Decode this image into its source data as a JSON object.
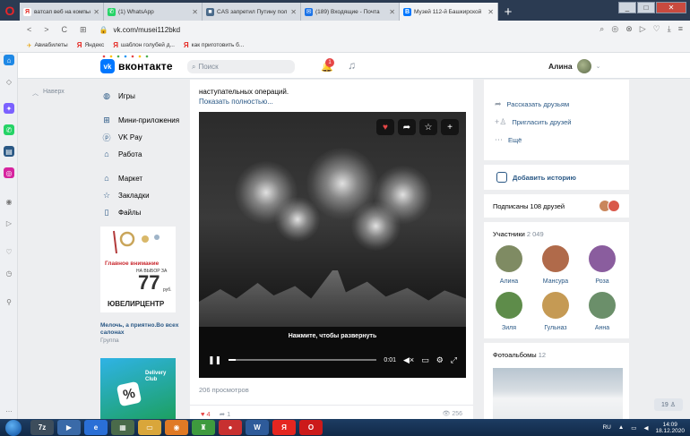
{
  "browser": {
    "tabs": [
      {
        "title": "ватсап веб на компьютер",
        "icon": "yandex-icon",
        "color": "#e52620",
        "glyph": "Я",
        "active": false
      },
      {
        "title": "(1) WhatsApp",
        "icon": "whatsapp-icon",
        "color": "#25d366",
        "glyph": "✆",
        "active": false
      },
      {
        "title": "CAS запретил Путину пол",
        "icon": "cas-icon",
        "color": "#4a6a8a",
        "glyph": "■",
        "active": false
      },
      {
        "title": "(189) Входящие - Почта",
        "icon": "mail-icon",
        "color": "#1a73e8",
        "glyph": "✉",
        "active": false
      },
      {
        "title": "Музей 112-й Башкирской",
        "icon": "vk-icon",
        "color": "#0077ff",
        "glyph": "В",
        "active": true
      }
    ],
    "url": "vk.com/musei112bkd",
    "bookmarks": [
      {
        "label": "Авиабилеты",
        "icon": "plane-icon"
      },
      {
        "label": "Яндекс",
        "icon": "yandex-icon"
      },
      {
        "label": "шаблон голубей д...",
        "icon": "yandex-icon"
      },
      {
        "label": "как приготовить б...",
        "icon": "yandex-icon"
      }
    ]
  },
  "vk": {
    "brand": "вконтакте",
    "search_placeholder": "Поиск",
    "notifications_count": "1",
    "user_name": "Алина",
    "back_to_top": "Наверх",
    "nav": [
      {
        "label": "Игры",
        "icon": "gamepad-icon",
        "badge": true
      },
      {
        "label": "Мини-приложения",
        "icon": "grid-icon"
      },
      {
        "label": "VK Pay",
        "icon": "pay-icon"
      },
      {
        "label": "Работа",
        "icon": "briefcase-icon"
      },
      {
        "label": "Маркет",
        "icon": "bag-icon"
      },
      {
        "label": "Закладки",
        "icon": "star-icon"
      },
      {
        "label": "Файлы",
        "icon": "file-icon"
      }
    ],
    "ad1": {
      "headline": "Главное внимание",
      "sub": "НА ВЫБОР ЗА",
      "price": "77",
      "unit": "руб.",
      "brand": "ЮВЕЛИРЦЕНТР",
      "text": "Мелочь, а приятно.Во всех салонах",
      "group": "Группа"
    },
    "ad2": {
      "label": "Delivery Club",
      "pct": "%"
    },
    "post": {
      "text": "наступательных операций.",
      "show_more": "Показать полностью...",
      "expand_hint": "Нажмите, чтобы развернуть",
      "time": "0:01",
      "progress": 0.05,
      "views": "206 просмотров",
      "likes": "4",
      "shares": "1",
      "eye_views": "256"
    },
    "right": {
      "share_friends": "Рассказать друзьям",
      "invite_friends": "Пригласить друзей",
      "more": "Ещё",
      "add_story": "Добавить историю",
      "subscribed": "Подписаны 108 друзей",
      "members_label": "Участники",
      "members_count": "2 049",
      "members": [
        {
          "name": "Алина",
          "color": "#7f8b63"
        },
        {
          "name": "Мансура",
          "color": "#b06a4a"
        },
        {
          "name": "Роза",
          "color": "#8a5d9e"
        },
        {
          "name": "Зиля",
          "color": "#5e8c4a"
        },
        {
          "name": "Гульназ",
          "color": "#c59a54"
        },
        {
          "name": "Анна",
          "color": "#6b8f6a"
        }
      ],
      "albums_label": "Фотоальбомы",
      "albums_count": "12"
    },
    "online_counter": "19"
  },
  "taskbar": {
    "lang": "RU",
    "time": "14:09",
    "date": "18.12.2020"
  }
}
